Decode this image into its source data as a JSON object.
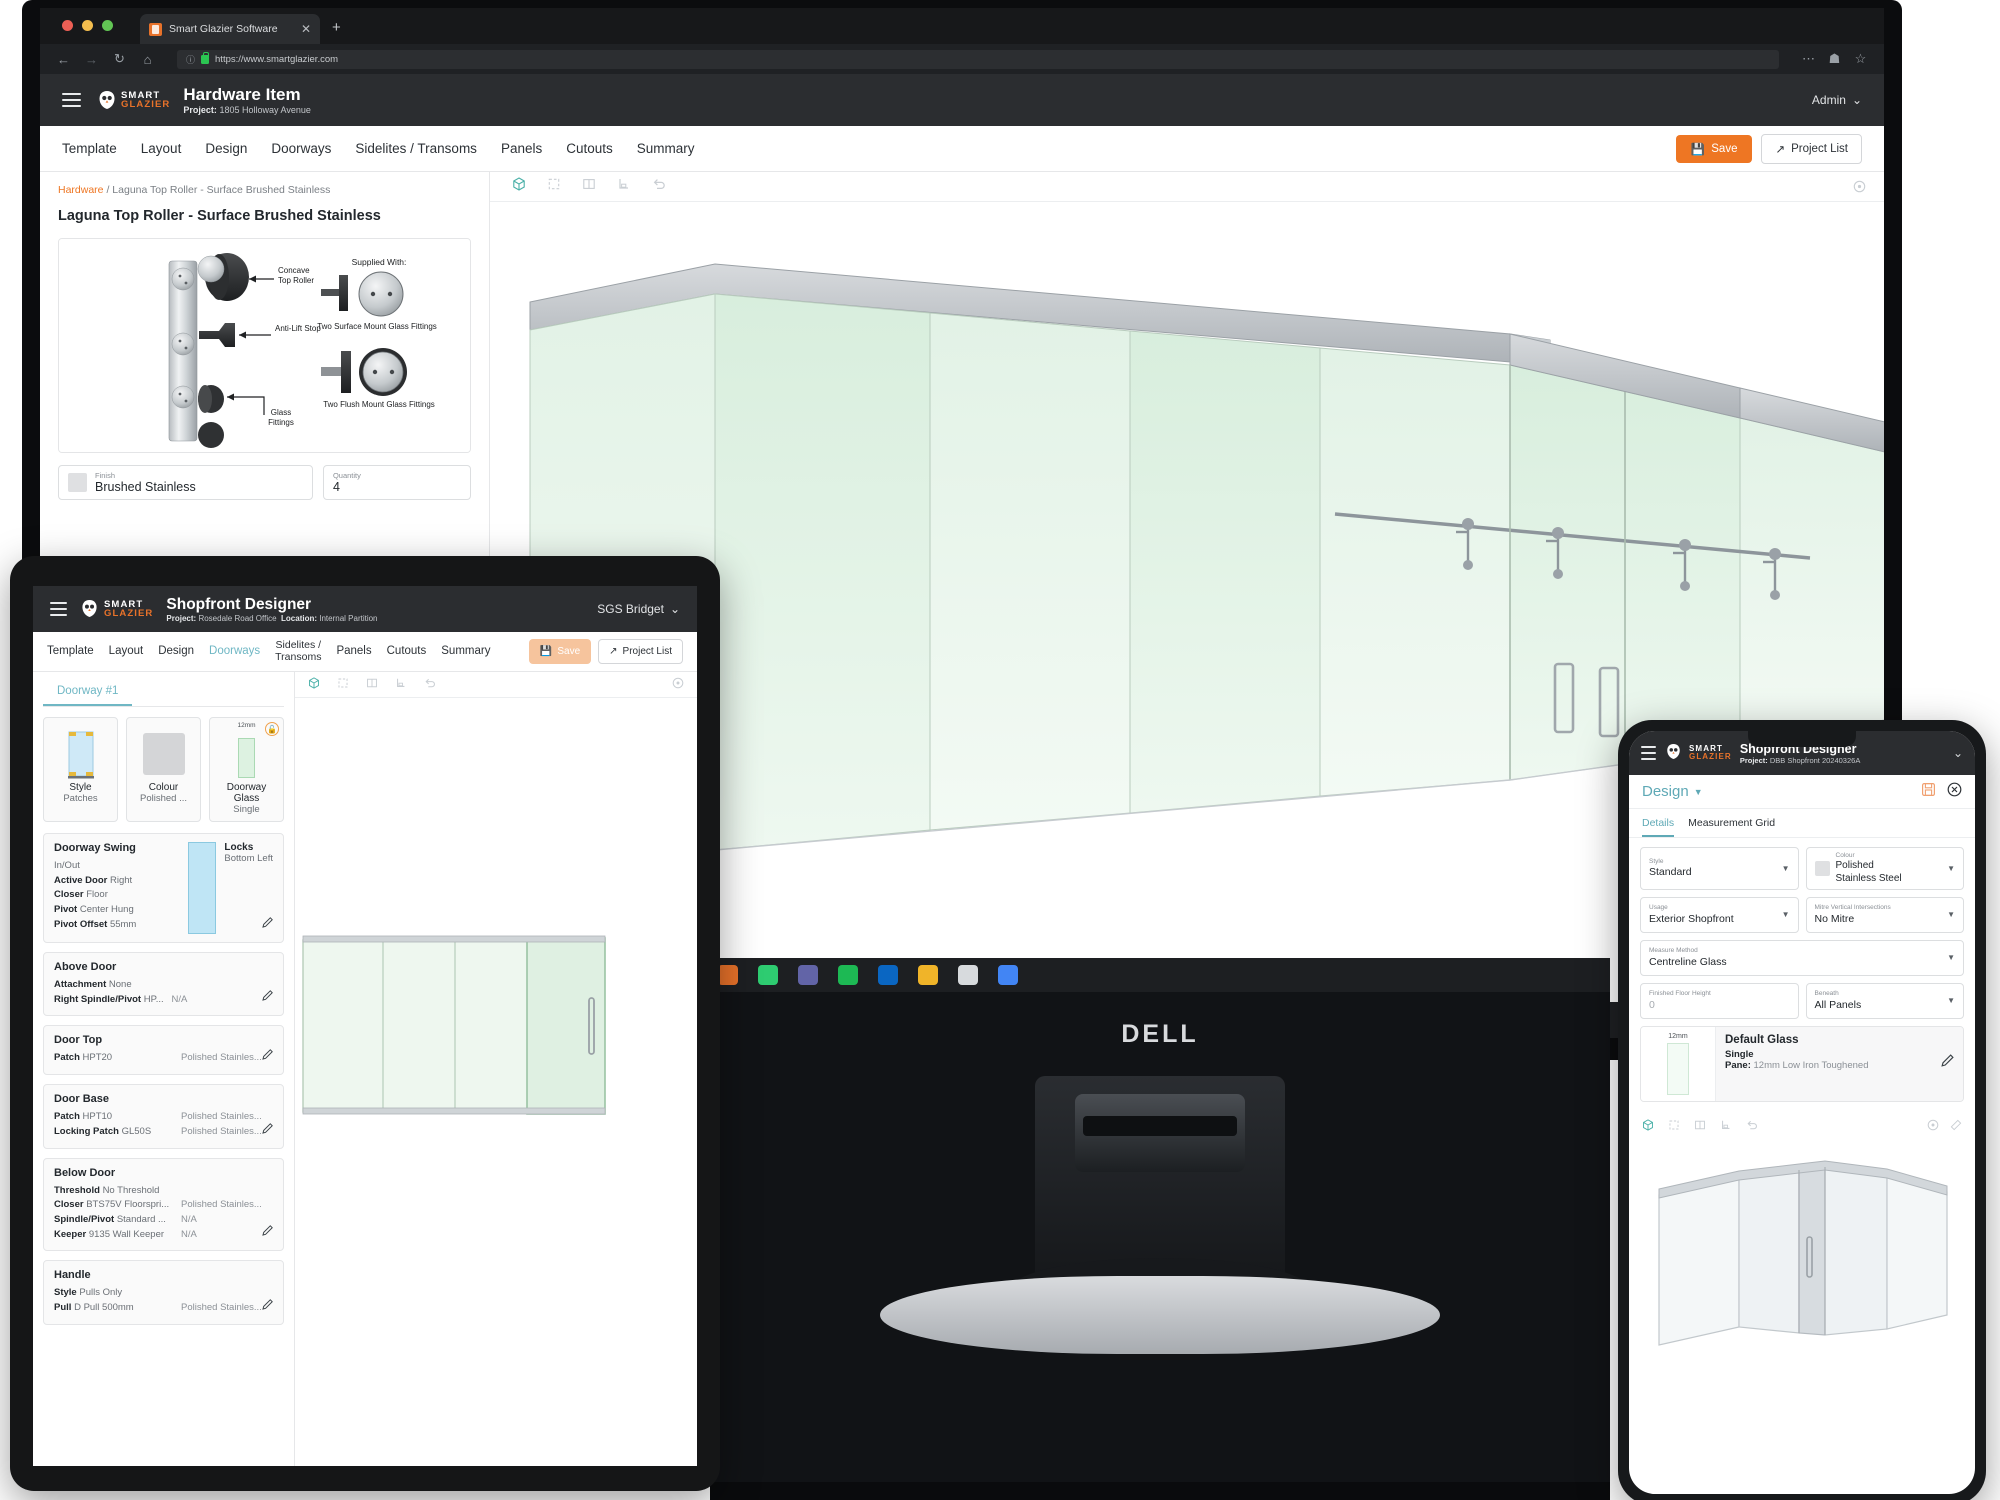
{
  "browser": {
    "tab_title": "Smart Glazier Software",
    "tab_close": "✕",
    "new_tab": "+",
    "url": "https://www.smartglazier.com",
    "back_icon": "back-arrow-icon",
    "forward_icon": "forward-arrow-icon",
    "reload_icon": "reload-icon",
    "home_icon": "home-icon"
  },
  "desktop": {
    "brand_top": "SMART",
    "brand_bottom": "GLAZIER",
    "title": "Hardware Item",
    "project_label": "Project:",
    "project_value": "1805 Holloway Avenue",
    "user": "Admin",
    "tabs": [
      "Template",
      "Layout",
      "Design",
      "Doorways",
      "Sidelites / Transoms",
      "Panels",
      "Cutouts",
      "Summary"
    ],
    "save_label": "Save",
    "project_list_label": "Project List",
    "breadcrumb_root": "Hardware",
    "breadcrumb_sep": "/",
    "breadcrumb_leaf": "Laguna Top Roller - Surface Brushed Stainless",
    "page_title": "Laguna Top Roller - Surface Brushed Stainless",
    "diagram": {
      "label_concave": "Concave\nTop Roller",
      "label_antilift": "Anti-Lift Stop",
      "label_glassfit": "Glass\nFittings",
      "label_supplied": "Supplied With:",
      "label_surface": "Two Surface Mount Glass Fittings",
      "label_flush": "Two Flush Mount Glass Fittings"
    },
    "finish_label": "Finish",
    "finish_value": "Brushed Stainless",
    "quantity_label": "Quantity",
    "quantity_value": "4"
  },
  "tablet": {
    "brand_top": "SMART",
    "brand_bottom": "GLAZIER",
    "title": "Shopfront Designer",
    "project_label": "Project:",
    "project_value": "Rosedale Road Office",
    "location_label": "Location:",
    "location_value": "Internal Partition",
    "user": "SGS Bridget",
    "tabs": [
      "Template",
      "Layout",
      "Design",
      "Doorways",
      "Sidelites /\nTransoms",
      "Panels",
      "Cutouts",
      "Summary"
    ],
    "active_tab": "Doorways",
    "save_label": "Save",
    "project_list_label": "Project List",
    "doorway_tab": "Doorway #1",
    "cards": [
      {
        "name": "Style",
        "value": "Patches"
      },
      {
        "name": "Colour",
        "value": "Polished ..."
      },
      {
        "name": "Doorway\nGlass",
        "value": "Single",
        "thickness": "12mm",
        "locked": true
      }
    ],
    "swing": {
      "heading": "Doorway Swing",
      "sub": "In/Out",
      "rows": [
        {
          "k": "Active Door",
          "v": "Right"
        },
        {
          "k": "Closer",
          "v": "Floor"
        },
        {
          "k": "Pivot",
          "v": "Center Hung"
        },
        {
          "k": "Pivot Offset",
          "v": "55mm"
        }
      ],
      "locks_label": "Locks",
      "locks_value": "Bottom Left"
    },
    "sections": [
      {
        "heading": "Above Door",
        "rows": [
          {
            "k": "Attachment",
            "v": "None",
            "v3": ""
          },
          {
            "k": "Right Spindle/Pivot",
            "v": "HP...",
            "v3": "N/A"
          }
        ]
      },
      {
        "heading": "Door Top",
        "rows": [
          {
            "k": "Patch",
            "v": "HPT20",
            "v3": "Polished Stainles..."
          }
        ]
      },
      {
        "heading": "Door Base",
        "rows": [
          {
            "k": "Patch",
            "v": "HPT10",
            "v3": "Polished Stainles..."
          },
          {
            "k": "Locking Patch",
            "v": "GL50S",
            "v3": "Polished Stainles..."
          }
        ]
      },
      {
        "heading": "Below Door",
        "rows": [
          {
            "k": "Threshold",
            "v": "No Threshold",
            "v3": ""
          },
          {
            "k": "Closer",
            "v": "BTS75V Floorspri...",
            "v3": "Polished Stainles..."
          },
          {
            "k": "Spindle/Pivot",
            "v": "Standard ...",
            "v3": "N/A"
          },
          {
            "k": "Keeper",
            "v": "9135 Wall Keeper",
            "v3": "N/A"
          }
        ]
      },
      {
        "heading": "Handle",
        "rows": [
          {
            "k": "Style",
            "v": "Pulls Only",
            "v3": ""
          },
          {
            "k": "Pull",
            "v": "D Pull 500mm",
            "v3": "Polished Stainles..."
          }
        ]
      }
    ]
  },
  "phone": {
    "brand_top": "SMART",
    "brand_bottom": "GLAZIER",
    "title": "Shopfront Designer",
    "project_label": "Project:",
    "project_value": "DBB Shopfront 20240326A",
    "section_title": "Design",
    "save_icon": "save-icon",
    "close_icon": "close-icon",
    "tabs": [
      "Details",
      "Measurement Grid"
    ],
    "active_tab": "Details",
    "fields": [
      {
        "label": "Style",
        "value": "Standard",
        "caret": true,
        "swatch": false
      },
      {
        "label": "Colour",
        "value": "Polished\nStainless Steel",
        "caret": true,
        "swatch": true
      },
      {
        "label": "Usage",
        "value": "Exterior Shopfront",
        "caret": true,
        "swatch": false
      },
      {
        "label": "Mitre Vertical Intersections",
        "value": "No Mitre",
        "caret": true,
        "swatch": false
      },
      {
        "label": "Measure Method",
        "value": "Centreline Glass",
        "caret": true,
        "swatch": false
      },
      {
        "label": "Finished Floor Height",
        "value": "0",
        "caret": false,
        "swatch": false
      },
      {
        "label": "Beneath",
        "value": "All Panels",
        "caret": true,
        "swatch": false
      }
    ],
    "glass": {
      "thickness": "12mm",
      "title": "Default Glass",
      "line1": "Single",
      "pane_label": "Pane:",
      "pane_value": "12mm Low Iron Toughened",
      "edit_icon": "edit-icon"
    }
  },
  "viewport_toolbar": {
    "icons": [
      "cube-icon",
      "frame-icon",
      "split-view-icon",
      "elevation-icon",
      "undo-icon"
    ],
    "right_icon": "settings-icon"
  },
  "monitor": {
    "brand": "DELL"
  },
  "colors": {
    "accent_orange": "#ee7623",
    "teal": "#5fa9b6",
    "header_dark": "#2b2d30",
    "glass_green": "#e7f4ea"
  }
}
